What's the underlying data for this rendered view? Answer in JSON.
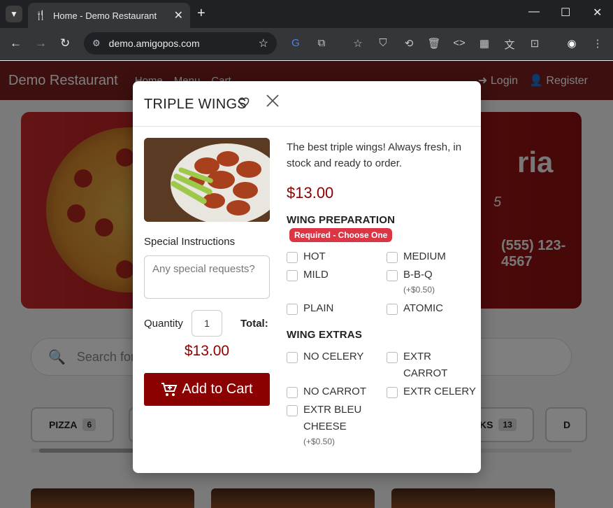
{
  "browser": {
    "tab_title": "Home - Demo Restaurant",
    "url": "demo.amigopos.com"
  },
  "site": {
    "brand": "Demo Restaurant",
    "nav": [
      "Home",
      "Menu",
      "Cart"
    ],
    "login": "Login",
    "register": "Register",
    "hero_title": "ria",
    "hero_sub": "5",
    "hero_phone": "(555) 123-4567",
    "search_placeholder": "Search for d",
    "categories": [
      {
        "label": "PIZZA",
        "count": "6"
      },
      {
        "label": "KS",
        "count": "13"
      },
      {
        "label": "D",
        "count": ""
      }
    ]
  },
  "modal": {
    "title": "TRIPLE WINGS",
    "description": "The best triple wings! Always fresh, in stock and ready to order.",
    "price": "$13.00",
    "special_label": "Special Instructions",
    "special_placeholder": "Any special requests?",
    "quantity_label": "Quantity",
    "quantity_value": "1",
    "total_label": "Total:",
    "total_value": "$13.00",
    "add_to_cart": "Add to Cart",
    "prep": {
      "title": "WING PREPARATION",
      "badge": "Required - Choose One",
      "options": [
        {
          "label": "HOT",
          "extra": ""
        },
        {
          "label": "MEDIUM",
          "extra": ""
        },
        {
          "label": "MILD",
          "extra": ""
        },
        {
          "label": "B-B-Q",
          "extra": "(+$0.50)"
        },
        {
          "label": "PLAIN",
          "extra": ""
        },
        {
          "label": "ATOMIC",
          "extra": ""
        }
      ]
    },
    "extras": {
      "title": "WING EXTRAS",
      "options": [
        {
          "label": "NO CELERY",
          "extra": ""
        },
        {
          "label": "EXTR CARROT",
          "extra": ""
        },
        {
          "label": "NO CARROT",
          "extra": ""
        },
        {
          "label": "EXTR CELERY",
          "extra": ""
        },
        {
          "label": "EXTR BLEU CHEESE",
          "extra": "(+$0.50)"
        }
      ]
    }
  }
}
